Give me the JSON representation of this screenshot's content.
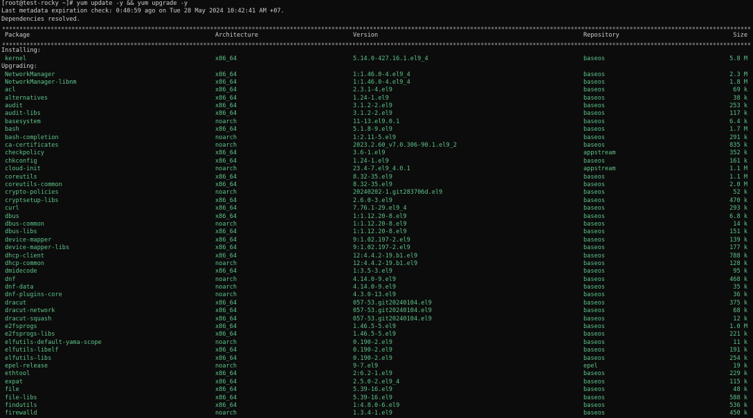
{
  "terminal": {
    "prompt_line": "[root@test-rocky ~]# yum update -y && yum upgrade -y",
    "metadata_line": "Last metadata expiration check: 0:40:59 ago on Tue 28 May 2024 10:42:41 AM +07.",
    "deps_line": "Dependencies resolved.",
    "text_color": "#d0d0d0",
    "package_color": "#5fc48a",
    "background": "#0c0c0c"
  },
  "table": {
    "headers": {
      "package": "Package",
      "arch": "Architecture",
      "version": "Version",
      "repo": "Repository",
      "size": "Size"
    },
    "installing_label": "Installing:",
    "installing": [
      {
        "pkg": "kernel",
        "arch": "x86_64",
        "ver": "5.14.0-427.16.1.el9_4",
        "repo": "baseos",
        "size": "5.8 M"
      }
    ],
    "upgrading_label": "Upgrading:",
    "upgrading": [
      {
        "pkg": "NetworkManager",
        "arch": "x86_64",
        "ver": "1:1.46.0-4.el9_4",
        "repo": "baseos",
        "size": "2.3 M"
      },
      {
        "pkg": "NetworkManager-libnm",
        "arch": "x86_64",
        "ver": "1:1.46.0-4.el9_4",
        "repo": "baseos",
        "size": "1.8 M"
      },
      {
        "pkg": "acl",
        "arch": "x86_64",
        "ver": "2.3.1-4.el9",
        "repo": "baseos",
        "size": "69 k"
      },
      {
        "pkg": "alternatives",
        "arch": "x86_64",
        "ver": "1.24-1.el9",
        "repo": "baseos",
        "size": "38 k"
      },
      {
        "pkg": "audit",
        "arch": "x86_64",
        "ver": "3.1.2-2.el9",
        "repo": "baseos",
        "size": "253 k"
      },
      {
        "pkg": "audit-libs",
        "arch": "x86_64",
        "ver": "3.1.2-2.el9",
        "repo": "baseos",
        "size": "117 k"
      },
      {
        "pkg": "basesystem",
        "arch": "noarch",
        "ver": "11-13.el9.0.1",
        "repo": "baseos",
        "size": "6.4 k"
      },
      {
        "pkg": "bash",
        "arch": "x86_64",
        "ver": "5.1.8-9.el9",
        "repo": "baseos",
        "size": "1.7 M"
      },
      {
        "pkg": "bash-completion",
        "arch": "noarch",
        "ver": "1:2.11-5.el9",
        "repo": "baseos",
        "size": "291 k"
      },
      {
        "pkg": "ca-certificates",
        "arch": "noarch",
        "ver": "2023.2.60_v7.0.306-90.1.el9_2",
        "repo": "baseos",
        "size": "835 k"
      },
      {
        "pkg": "checkpolicy",
        "arch": "x86_64",
        "ver": "3.6-1.el9",
        "repo": "appstream",
        "size": "352 k"
      },
      {
        "pkg": "chkconfig",
        "arch": "x86_64",
        "ver": "1.24-1.el9",
        "repo": "baseos",
        "size": "161 k"
      },
      {
        "pkg": "cloud-init",
        "arch": "noarch",
        "ver": "23.4-7.el9_4.0.1",
        "repo": "appstream",
        "size": "1.1 M"
      },
      {
        "pkg": "coreutils",
        "arch": "x86_64",
        "ver": "8.32-35.el9",
        "repo": "baseos",
        "size": "1.1 M"
      },
      {
        "pkg": "coreutils-common",
        "arch": "x86_64",
        "ver": "8.32-35.el9",
        "repo": "baseos",
        "size": "2.0 M"
      },
      {
        "pkg": "crypto-policies",
        "arch": "noarch",
        "ver": "20240202-1.git283706d.el9",
        "repo": "baseos",
        "size": "52 k"
      },
      {
        "pkg": "cryptsetup-libs",
        "arch": "x86_64",
        "ver": "2.6.0-3.el9",
        "repo": "baseos",
        "size": "470 k"
      },
      {
        "pkg": "curl",
        "arch": "x86_64",
        "ver": "7.76.1-29.el9_4",
        "repo": "baseos",
        "size": "293 k"
      },
      {
        "pkg": "dbus",
        "arch": "x86_64",
        "ver": "1:1.12.20-8.el9",
        "repo": "baseos",
        "size": "6.8 k"
      },
      {
        "pkg": "dbus-common",
        "arch": "noarch",
        "ver": "1:1.12.20-8.el9",
        "repo": "baseos",
        "size": "14 k"
      },
      {
        "pkg": "dbus-libs",
        "arch": "x86_64",
        "ver": "1:1.12.20-8.el9",
        "repo": "baseos",
        "size": "151 k"
      },
      {
        "pkg": "device-mapper",
        "arch": "x86_64",
        "ver": "9:1.02.197-2.el9",
        "repo": "baseos",
        "size": "139 k"
      },
      {
        "pkg": "device-mapper-libs",
        "arch": "x86_64",
        "ver": "9:1.02.197-2.el9",
        "repo": "baseos",
        "size": "177 k"
      },
      {
        "pkg": "dhcp-client",
        "arch": "x86_64",
        "ver": "12:4.4.2-19.b1.el9",
        "repo": "baseos",
        "size": "788 k"
      },
      {
        "pkg": "dhcp-common",
        "arch": "noarch",
        "ver": "12:4.4.2-19.b1.el9",
        "repo": "baseos",
        "size": "128 k"
      },
      {
        "pkg": "dmidecode",
        "arch": "x86_64",
        "ver": "1:3.5-3.el9",
        "repo": "baseos",
        "size": "95 k"
      },
      {
        "pkg": "dnf",
        "arch": "noarch",
        "ver": "4.14.0-9.el9",
        "repo": "baseos",
        "size": "468 k"
      },
      {
        "pkg": "dnf-data",
        "arch": "noarch",
        "ver": "4.14.0-9.el9",
        "repo": "baseos",
        "size": "35 k"
      },
      {
        "pkg": "dnf-plugins-core",
        "arch": "noarch",
        "ver": "4.3.0-13.el9",
        "repo": "baseos",
        "size": "36 k"
      },
      {
        "pkg": "dracut",
        "arch": "x86_64",
        "ver": "057-53.git20240104.el9",
        "repo": "baseos",
        "size": "375 k"
      },
      {
        "pkg": "dracut-network",
        "arch": "x86_64",
        "ver": "057-53.git20240104.el9",
        "repo": "baseos",
        "size": "68 k"
      },
      {
        "pkg": "dracut-squash",
        "arch": "x86_64",
        "ver": "057-53.git20240104.el9",
        "repo": "baseos",
        "size": "12 k"
      },
      {
        "pkg": "e2fsprogs",
        "arch": "x86_64",
        "ver": "1.46.5-5.el9",
        "repo": "baseos",
        "size": "1.0 M"
      },
      {
        "pkg": "e2fsprogs-libs",
        "arch": "x86_64",
        "ver": "1.46.5-5.el9",
        "repo": "baseos",
        "size": "221 k"
      },
      {
        "pkg": "elfutils-default-yama-scope",
        "arch": "noarch",
        "ver": "0.190-2.el9",
        "repo": "baseos",
        "size": "11 k"
      },
      {
        "pkg": "elfutils-libelf",
        "arch": "x86_64",
        "ver": "0.190-2.el9",
        "repo": "baseos",
        "size": "191 k"
      },
      {
        "pkg": "elfutils-libs",
        "arch": "x86_64",
        "ver": "0.190-2.el9",
        "repo": "baseos",
        "size": "254 k"
      },
      {
        "pkg": "epel-release",
        "arch": "noarch",
        "ver": "9-7.el9",
        "repo": "epel",
        "size": "19 k"
      },
      {
        "pkg": "ethtool",
        "arch": "x86_64",
        "ver": "2:6.2-1.el9",
        "repo": "baseos",
        "size": "229 k"
      },
      {
        "pkg": "expat",
        "arch": "x86_64",
        "ver": "2.5.0-2.el9_4",
        "repo": "baseos",
        "size": "115 k"
      },
      {
        "pkg": "file",
        "arch": "x86_64",
        "ver": "5.39-16.el9",
        "repo": "baseos",
        "size": "48 k"
      },
      {
        "pkg": "file-libs",
        "arch": "x86_64",
        "ver": "5.39-16.el9",
        "repo": "baseos",
        "size": "588 k"
      },
      {
        "pkg": "findutils",
        "arch": "x86_64",
        "ver": "1:4.8.0-6.el9",
        "repo": "baseos",
        "size": "536 k"
      },
      {
        "pkg": "firewalld",
        "arch": "noarch",
        "ver": "1.3.4-1.el9",
        "repo": "baseos",
        "size": "450 k"
      }
    ]
  }
}
